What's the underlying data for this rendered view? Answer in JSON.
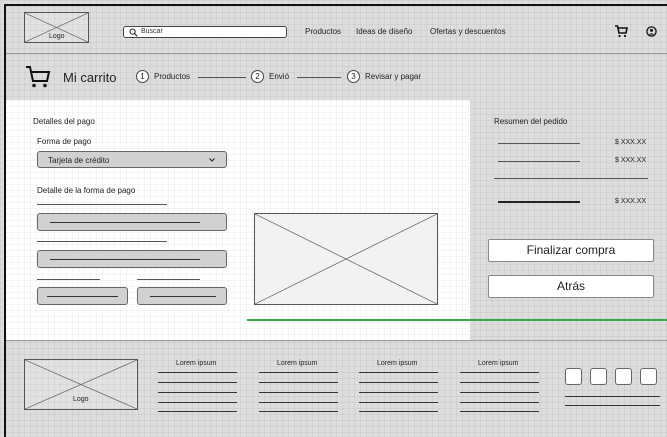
{
  "header": {
    "logo_label": "Logo",
    "search_placeholder": "Buscar",
    "nav": [
      "Productos",
      "Ideas de diseño",
      "Ofertas y descuentos"
    ]
  },
  "steps": {
    "title": "Mi carrito",
    "items": [
      {
        "num": "1",
        "label": "Productos"
      },
      {
        "num": "2",
        "label": "Envió"
      },
      {
        "num": "3",
        "label": "Revisar y pagar"
      }
    ]
  },
  "payment": {
    "section_title": "Detalles del pago",
    "method_label": "Forma de pago",
    "method_value": "Tarjeta de crédito",
    "detail_label": "Detalle de la forma de pago"
  },
  "summary": {
    "title": "Resumen del pedido",
    "amounts": [
      "$ XXX.XX",
      "$ XXX.XX",
      "$ XXX.XX"
    ],
    "finish_label": "Finalizar compra",
    "back_label": "Atrás"
  },
  "footer": {
    "logo_label": "Logo",
    "columns": [
      "Lorem ipsum",
      "Lorem ipsum",
      "Lorem ipsum",
      "Lorem ipsum"
    ]
  },
  "colors": {
    "accent_line": "#3aa84a"
  }
}
